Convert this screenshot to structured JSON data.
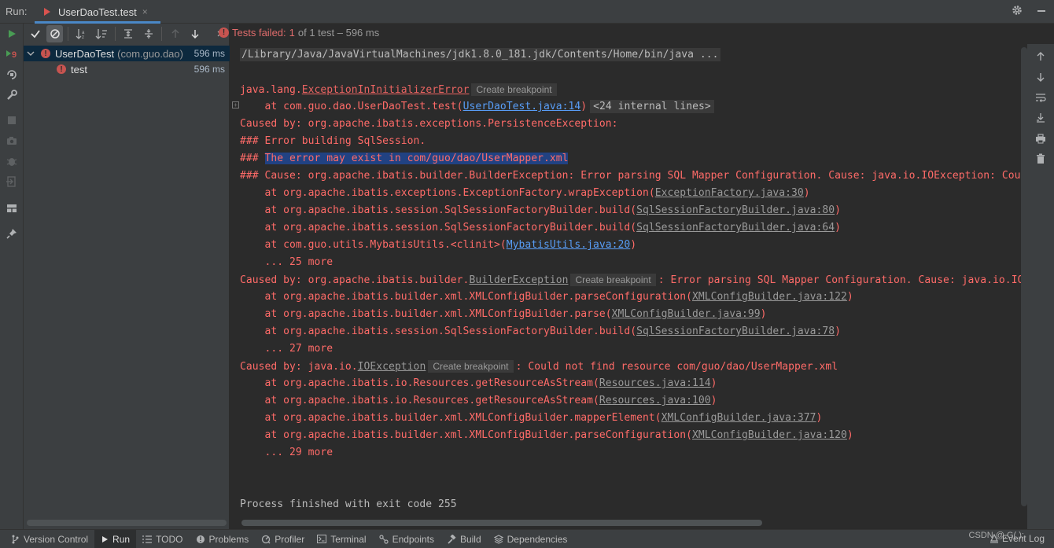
{
  "titlebar": {
    "run_label": "Run:",
    "tab_title": "UserDaoTest.test",
    "tab_close": "×"
  },
  "status": {
    "failed_label": "Tests failed:",
    "failed_count": "1",
    "of_text": "of 1 test – 596 ms"
  },
  "tree": {
    "root_name": "UserDaoTest",
    "root_package": "(com.guo.dao)",
    "root_time": "596 ms",
    "child_name": "test",
    "child_time": "596 ms"
  },
  "console": {
    "l0": "/Library/Java/JavaVirtualMachines/jdk1.8.0_181.jdk/Contents/Home/bin/java ...",
    "l1_pre": "java.lang.",
    "l1_cls": "ExceptionInInitializerError",
    "l1_bp": "Create breakpoint",
    "l2_pre": "    at com.guo.dao.UserDaoTest.test(",
    "l2_link": "UserDaoTest.java:14",
    "l2_post": ")",
    "l2_internal": "<24 internal lines>",
    "l3": "Caused by: org.apache.ibatis.exceptions.PersistenceException: ",
    "l4": "### Error building SqlSession.",
    "l5_pre": "### ",
    "l5_sel": "The error may exist in com/guo/dao/UserMapper.xml",
    "l6": "### Cause: org.apache.ibatis.builder.BuilderException: Error parsing SQL Mapper Configuration. Cause: java.io.IOException: Coul",
    "l7_pre": "    at org.apache.ibatis.exceptions.ExceptionFactory.wrapException(",
    "l7_link": "ExceptionFactory.java:30",
    "l8_pre": "    at org.apache.ibatis.session.SqlSessionFactoryBuilder.build(",
    "l8_link": "SqlSessionFactoryBuilder.java:80",
    "l9_pre": "    at org.apache.ibatis.session.SqlSessionFactoryBuilder.build(",
    "l9_link": "SqlSessionFactoryBuilder.java:64",
    "l10_pre": "    at com.guo.utils.MybatisUtils.<clinit>(",
    "l10_link": "MybatisUtils.java:20",
    "l11": "    ... 25 more",
    "l12_pre": "Caused by: org.apache.ibatis.builder.",
    "l12_cls": "BuilderException",
    "l12_bp": "Create breakpoint",
    "l12_post": ": Error parsing SQL Mapper Configuration. Cause: java.io.IO",
    "l13_pre": "    at org.apache.ibatis.builder.xml.XMLConfigBuilder.parseConfiguration(",
    "l13_link": "XMLConfigBuilder.java:122",
    "l14_pre": "    at org.apache.ibatis.builder.xml.XMLConfigBuilder.parse(",
    "l14_link": "XMLConfigBuilder.java:99",
    "l15_pre": "    at org.apache.ibatis.session.SqlSessionFactoryBuilder.build(",
    "l15_link": "SqlSessionFactoryBuilder.java:78",
    "l16": "    ... 27 more",
    "l17_pre": "Caused by: java.io.",
    "l17_cls": "IOException",
    "l17_bp": "Create breakpoint",
    "l17_post": ": Could not find resource com/guo/dao/UserMapper.xml",
    "l18_pre": "    at org.apache.ibatis.io.Resources.getResourceAsStream(",
    "l18_link": "Resources.java:114",
    "l19_pre": "    at org.apache.ibatis.io.Resources.getResourceAsStream(",
    "l19_link": "Resources.java:100",
    "l20_pre": "    at org.apache.ibatis.builder.xml.XMLConfigBuilder.mapperElement(",
    "l20_link": "XMLConfigBuilder.java:377",
    "l21_pre": "    at org.apache.ibatis.builder.xml.XMLConfigBuilder.parseConfiguration(",
    "l21_link": "XMLConfigBuilder.java:120",
    "l22": "    ... 29 more",
    "l23": "Process finished with exit code 255",
    "close_paren": ")"
  },
  "bottombar": {
    "version_control": "Version Control",
    "run": "Run",
    "todo": "TODO",
    "problems": "Problems",
    "profiler": "Profiler",
    "terminal": "Terminal",
    "endpoints": "Endpoints",
    "build": "Build",
    "dependencies": "Dependencies",
    "event_log": "Event Log",
    "watermark": "CSDN @.G( );"
  },
  "colors": {
    "error_red": "#ff6b68",
    "link_blue": "#589df6",
    "selection": "#214283",
    "run_green": "#499c54"
  }
}
